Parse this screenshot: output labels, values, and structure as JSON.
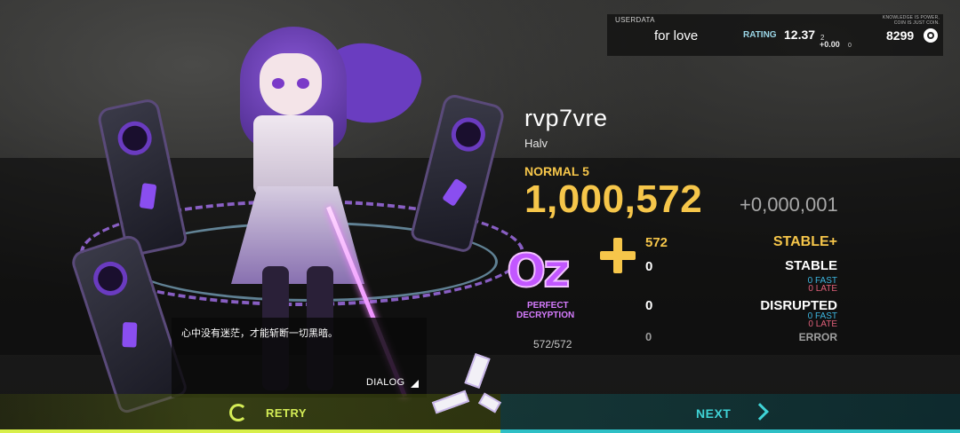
{
  "userdata": {
    "caption": "USERDATA",
    "username": "for love",
    "rating_label": "RATING",
    "rating_value": "12.37",
    "rating_sub": "2",
    "rating_delta": "+0.00",
    "rating_delta_sub": "0",
    "motto_line1": "KNOWLEDGE IS POWER,",
    "motto_line2": "COIN IS JUST COIN.",
    "coins": "8299",
    "coin_icon": "coin-icon"
  },
  "song": {
    "title": "rvp7vre",
    "artist": "Halv",
    "difficulty": "NORMAL 5",
    "score": "1,000,572",
    "score_delta": "+0,000,001"
  },
  "grade": {
    "letters": "Oz",
    "title_line1": "PERFECT",
    "title_line2": "DECRYPTION",
    "plus_icon": "plus-icon"
  },
  "judgements": {
    "stable_plus": {
      "label": "STABLE+",
      "count": "572"
    },
    "stable": {
      "label": "STABLE",
      "count": "0",
      "fast": "0 FAST",
      "late": "0 LATE"
    },
    "disrupted": {
      "label": "DISRUPTED",
      "count": "0",
      "fast": "0 FAST",
      "late": "0 LATE"
    },
    "error": {
      "label": "ERROR",
      "count": "0"
    }
  },
  "dialog": {
    "text": "心中没有迷茫，才能斩断一切黑暗。",
    "button_label": "DIALOG",
    "note_count": "572/572"
  },
  "bottom": {
    "retry_label": "RETRY",
    "next_label": "NEXT"
  },
  "colors": {
    "accent_gold": "#f6c64a",
    "grade_purple": "#c257ff",
    "retry_green": "#d4ec56",
    "next_cyan": "#3fd3d6",
    "fast_blue": "#3db6e0",
    "late_red": "#e0607a"
  }
}
